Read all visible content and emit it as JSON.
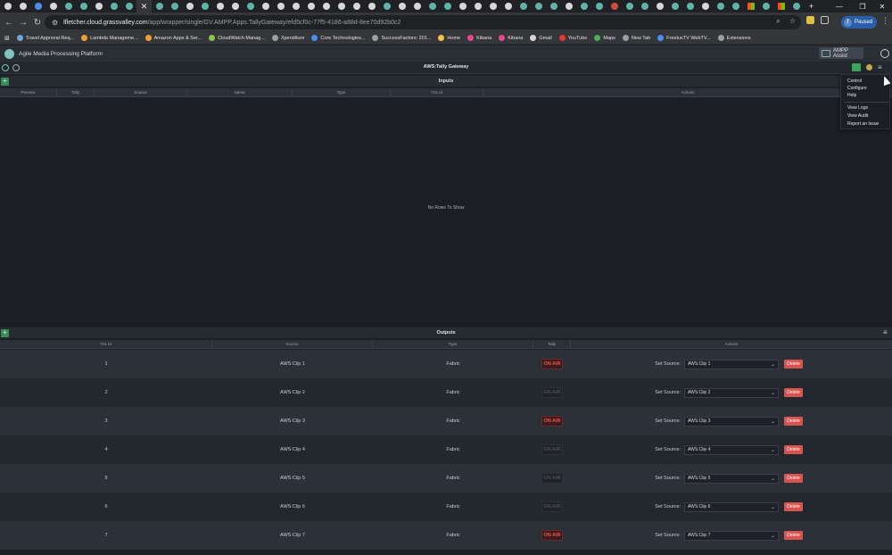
{
  "browser": {
    "url_host": "lfletcher.cloud.grassvalley.com",
    "url_path": "/app/wrapper/single/GV.AMPP.Apps.TallyGateway/efd5cf0c-77f5-4186-a88d-8ee70d92b0c2",
    "profile_initial": "T",
    "profile_status": "Paused",
    "bookmarks": [
      {
        "label": "Travel Approval Req...",
        "color": "#6fa8dc"
      },
      {
        "label": "Lambda Manageme...",
        "color": "#f0a030"
      },
      {
        "label": "Amazon Apps & Ser...",
        "color": "#f0a030"
      },
      {
        "label": "CloudWatch Manag...",
        "color": "#8bc34a"
      },
      {
        "label": "Xpenditure",
        "color": "#9aa0a6"
      },
      {
        "label": "Core Technologies...",
        "color": "#4a8ff0"
      },
      {
        "label": "SuccessFactors: 201...",
        "color": "#9aa0a6"
      },
      {
        "label": "Home",
        "color": "#f6c344"
      },
      {
        "label": "Kibana",
        "color": "#e8478b"
      },
      {
        "label": "Kibana",
        "color": "#e8478b"
      },
      {
        "label": "Gmail",
        "color": "#d7d7d7"
      },
      {
        "label": "YouTube",
        "color": "#e53935"
      },
      {
        "label": "Maps",
        "color": "#4caf50"
      },
      {
        "label": "New Tab",
        "color": "#9aa0a6"
      },
      {
        "label": "FreetuxTV WebTV...",
        "color": "#4a8ff0"
      },
      {
        "label": "Extensions",
        "color": "#9aa0a6"
      }
    ]
  },
  "app": {
    "title": "Agile Media Processing Platform",
    "assist_label": "AMPP Assist",
    "gateway_title": "AWS:Tally Gateway"
  },
  "inputs": {
    "title": "Inputs",
    "columns": [
      "Preview",
      "Tally",
      "Source",
      "Name",
      "Type",
      "TSL Id",
      "Actions"
    ],
    "empty_message": "No Rows To Show"
  },
  "outputs": {
    "title": "Outputs",
    "columns": [
      "TSL Id",
      "Source",
      "Type",
      "Tally",
      "Actions"
    ],
    "set_source_label": "Set Source:",
    "delete_label": "Delete",
    "rows": [
      {
        "tsl_id": "1",
        "source": "AWS:Clip 1",
        "type": "Fabric",
        "tally": "ON AIR",
        "tally_on": true,
        "selected": "AWS:Clip 1"
      },
      {
        "tsl_id": "2",
        "source": "AWS:Clip 2",
        "type": "Fabric",
        "tally": "ON AIR",
        "tally_on": false,
        "selected": "AWS:Clip 2"
      },
      {
        "tsl_id": "3",
        "source": "AWS:Clip 3",
        "type": "Fabric",
        "tally": "ON AIR",
        "tally_on": true,
        "selected": "AWS:Clip 3"
      },
      {
        "tsl_id": "4",
        "source": "AWS:Clip 4",
        "type": "Fabric",
        "tally": "ON AIR",
        "tally_on": false,
        "selected": "AWS:Clip 4"
      },
      {
        "tsl_id": "5",
        "source": "AWS:Clip 5",
        "type": "Fabric",
        "tally": "ON AIR",
        "tally_on": false,
        "selected": "AWS:Clip 5"
      },
      {
        "tsl_id": "6",
        "source": "AWS:Clip 6",
        "type": "Fabric",
        "tally": "ON AIR",
        "tally_on": false,
        "selected": "AWS:Clip 6"
      },
      {
        "tsl_id": "7",
        "source": "AWS:Clip 7",
        "type": "Fabric",
        "tally": "ON AIR",
        "tally_on": true,
        "selected": "AWS:Clip 7"
      }
    ]
  },
  "menu": {
    "items": [
      "Control",
      "Configure",
      "Help",
      "View Logs",
      "View Audit",
      "Report an Issue"
    ]
  },
  "colors": {
    "on_air": "#ff4d4d",
    "delete": "#d9534f",
    "accent": "#3fa35b"
  }
}
